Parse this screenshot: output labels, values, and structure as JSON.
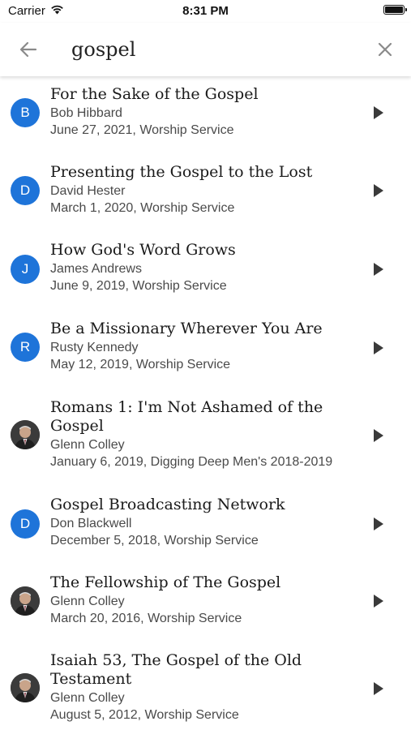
{
  "status_bar": {
    "carrier": "Carrier",
    "time": "8:31 PM"
  },
  "search": {
    "value": "gospel"
  },
  "results": [
    {
      "avatar_type": "letter",
      "avatar_letter": "B",
      "title": "For the Sake of the Gospel",
      "speaker": "Bob Hibbard",
      "meta": "June 27, 2021, Worship Service"
    },
    {
      "avatar_type": "letter",
      "avatar_letter": "D",
      "title": "Presenting the Gospel to the Lost",
      "speaker": "David Hester",
      "meta": "March 1, 2020, Worship Service"
    },
    {
      "avatar_type": "letter",
      "avatar_letter": "J",
      "title": "How God's Word Grows",
      "speaker": "James Andrews",
      "meta": "June 9, 2019, Worship Service"
    },
    {
      "avatar_type": "letter",
      "avatar_letter": "R",
      "title": "Be a Missionary Wherever You Are",
      "speaker": "Rusty Kennedy",
      "meta": "May 12, 2019, Worship Service"
    },
    {
      "avatar_type": "photo",
      "avatar_letter": "",
      "title": "Romans 1: I'm Not Ashamed of the Gospel",
      "speaker": "Glenn Colley",
      "meta": "January 6, 2019, Digging Deep Men's 2018-2019"
    },
    {
      "avatar_type": "letter",
      "avatar_letter": "D",
      "title": "Gospel Broadcasting Network",
      "speaker": "Don Blackwell",
      "meta": "December 5, 2018, Worship Service"
    },
    {
      "avatar_type": "photo",
      "avatar_letter": "",
      "title": "The Fellowship of The Gospel",
      "speaker": "Glenn Colley",
      "meta": "March 20, 2016, Worship Service"
    },
    {
      "avatar_type": "photo",
      "avatar_letter": "",
      "title": "Isaiah 53, The Gospel of the Old Testament",
      "speaker": "Glenn Colley",
      "meta": "August 5, 2012, Worship Service"
    }
  ],
  "colors": {
    "avatar_blue": "#1e74d9",
    "play_icon": "#3a3a3a",
    "header_icon": "#8a8a8a"
  }
}
